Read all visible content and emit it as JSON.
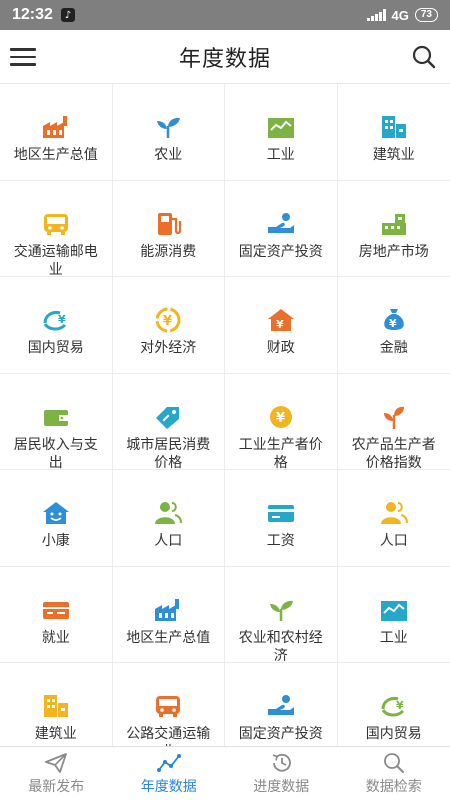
{
  "status": {
    "time": "12:32",
    "network": "4G",
    "battery": "73"
  },
  "header": {
    "title": "年度数据"
  },
  "grid": [
    {
      "label": "地区生产总值",
      "icon": "factory-icon",
      "color": "#e8702a"
    },
    {
      "label": "农业",
      "icon": "sprout-icon",
      "color": "#2e8fd6"
    },
    {
      "label": "工业",
      "icon": "industry-chart-icon",
      "color": "#7cb342"
    },
    {
      "label": "建筑业",
      "icon": "building-icon",
      "color": "#26a6c8"
    },
    {
      "label": "交通运输邮电业",
      "icon": "bus-icon",
      "color": "#f3b51f"
    },
    {
      "label": "能源消费",
      "icon": "fuel-pump-icon",
      "color": "#e8702a"
    },
    {
      "label": "固定资产投资",
      "icon": "hand-investment-icon",
      "color": "#2e8fd6"
    },
    {
      "label": "房地产市场",
      "icon": "real-estate-icon",
      "color": "#7cb342"
    },
    {
      "label": "国内贸易",
      "icon": "yuan-trade-icon",
      "color": "#26a6c8"
    },
    {
      "label": "对外经济",
      "icon": "yuan-exchange-icon",
      "color": "#f3b51f"
    },
    {
      "label": "财政",
      "icon": "finance-house-icon",
      "color": "#e8702a"
    },
    {
      "label": "金融",
      "icon": "money-bag-icon",
      "color": "#2e8fd6"
    },
    {
      "label": "居民收入与支出",
      "icon": "wallet-icon",
      "color": "#7cb342"
    },
    {
      "label": "城市居民消费价格",
      "icon": "price-tag-icon",
      "color": "#26a6c8"
    },
    {
      "label": "工业生产者价格",
      "icon": "yuan-coin-icon",
      "color": "#f3b51f"
    },
    {
      "label": "农产品生产者价格指数",
      "icon": "plant-icon",
      "color": "#e8702a"
    },
    {
      "label": "小康",
      "icon": "smile-house-icon",
      "color": "#2e8fd6"
    },
    {
      "label": "人口",
      "icon": "people-icon",
      "color": "#7cb342"
    },
    {
      "label": "工资",
      "icon": "card-icon",
      "color": "#26a6c8"
    },
    {
      "label": "人口",
      "icon": "people-icon",
      "color": "#f3b51f"
    },
    {
      "label": "就业",
      "icon": "employment-card-icon",
      "color": "#e8702a"
    },
    {
      "label": "地区生产总值",
      "icon": "factory-icon",
      "color": "#2e8fd6"
    },
    {
      "label": "农业和农村经济",
      "icon": "sprout-icon",
      "color": "#7cb342"
    },
    {
      "label": "工业",
      "icon": "industry-chart-icon",
      "color": "#26a6c8"
    },
    {
      "label": "建筑业",
      "icon": "building-icon",
      "color": "#f3b51f"
    },
    {
      "label": "公路交通运输业",
      "icon": "bus-icon",
      "color": "#e8702a"
    },
    {
      "label": "固定资产投资",
      "icon": "hand-investment-icon",
      "color": "#2e8fd6"
    },
    {
      "label": "国内贸易",
      "icon": "yuan-trade-icon",
      "color": "#7cb342"
    }
  ],
  "tabs": [
    {
      "label": "最新发布",
      "icon": "paper-plane-icon",
      "active": false
    },
    {
      "label": "年度数据",
      "icon": "line-chart-icon",
      "active": true
    },
    {
      "label": "进度数据",
      "icon": "history-icon",
      "active": false
    },
    {
      "label": "数据检索",
      "icon": "search-icon",
      "active": false
    }
  ],
  "colors": {
    "accent": "#2b86d8",
    "status_bar": "#7f7f7f"
  }
}
